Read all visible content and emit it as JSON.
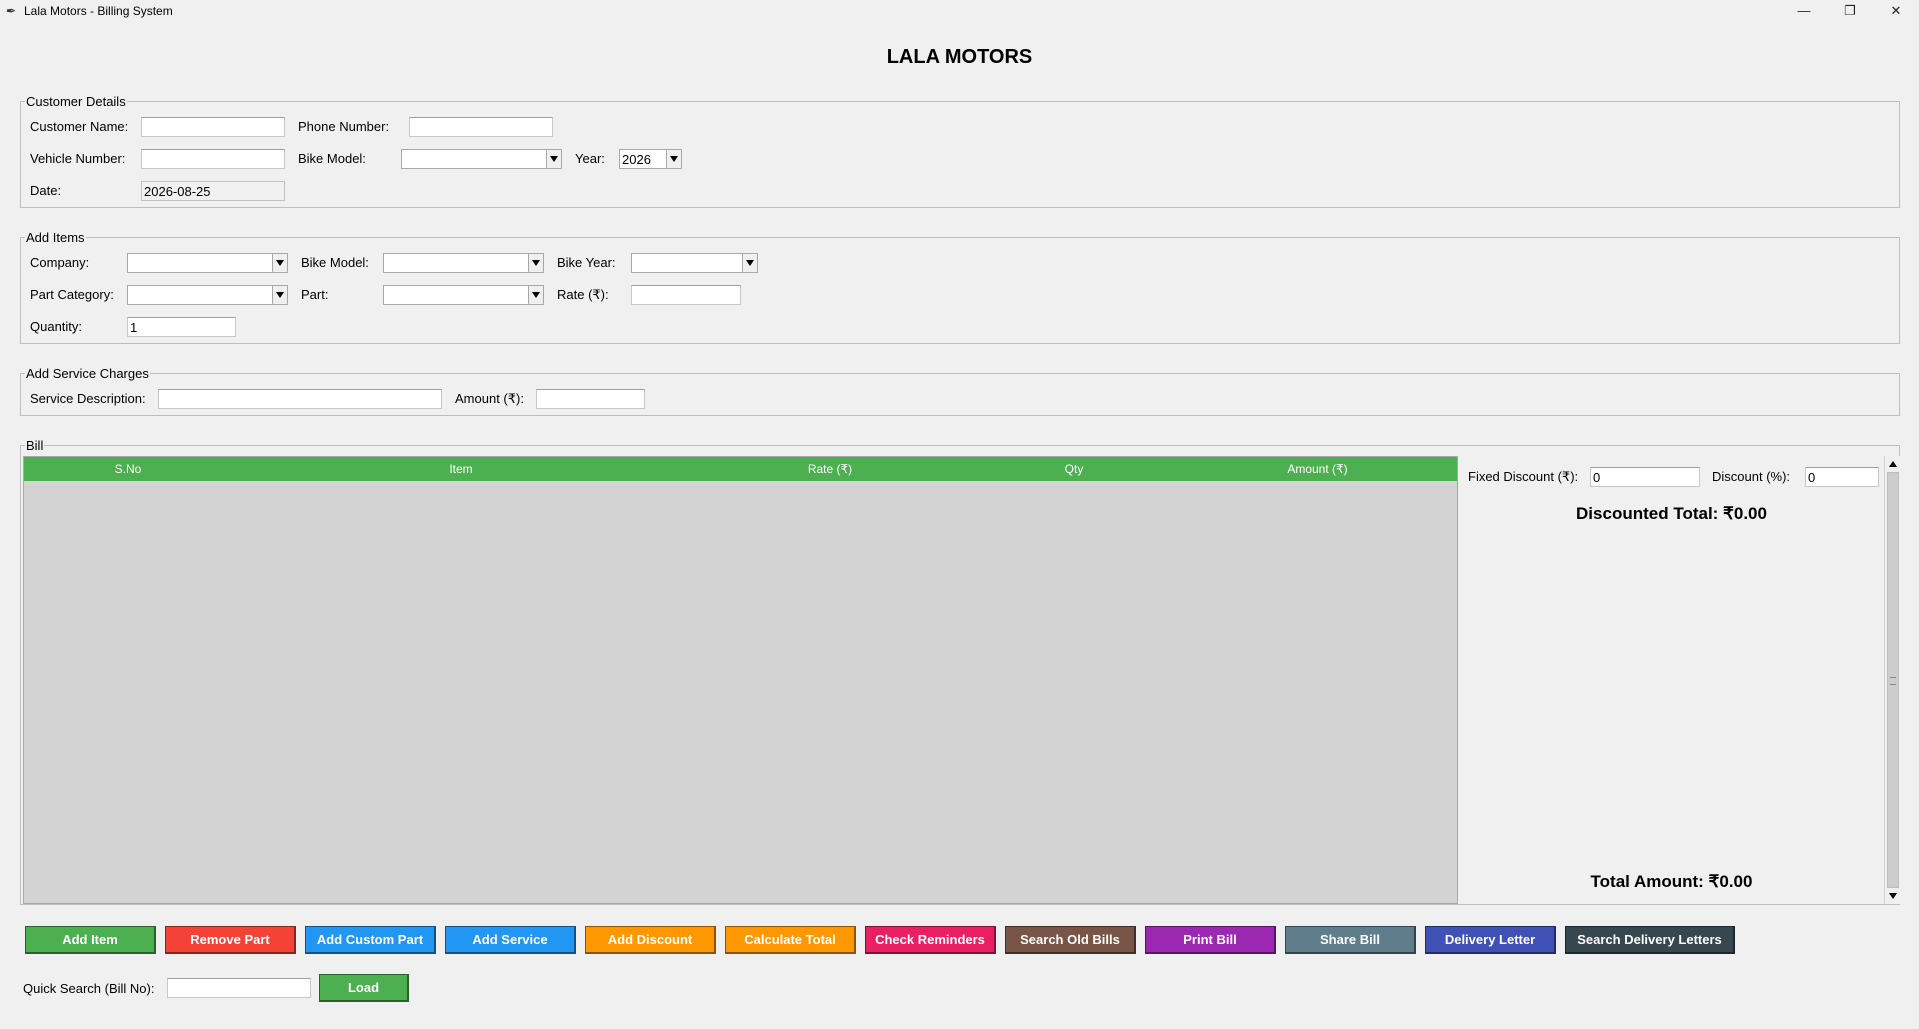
{
  "window": {
    "title": "Lala Motors - Billing System",
    "minimize_glyph": "—",
    "restore_glyph": "❐",
    "close_glyph": "✕"
  },
  "app": {
    "heading": "LALA MOTORS"
  },
  "customer_details": {
    "legend": "Customer Details",
    "customer_name_label": "Customer Name:",
    "customer_name_value": "",
    "phone_label": "Phone Number:",
    "phone_value": "",
    "vehicle_number_label": "Vehicle Number:",
    "vehicle_number_value": "",
    "bike_model_label": "Bike Model:",
    "bike_model_value": "",
    "year_label": "Year:",
    "year_value": "2026",
    "date_label": "Date:",
    "date_value": "2026-08-25"
  },
  "add_items": {
    "legend": "Add Items",
    "company_label": "Company:",
    "company_value": "",
    "bike_model_label": "Bike Model:",
    "bike_model_value": "",
    "bike_year_label": "Bike Year:",
    "bike_year_value": "",
    "part_category_label": "Part Category:",
    "part_category_value": "",
    "part_label": "Part:",
    "part_value": "",
    "rate_label": "Rate (₹):",
    "rate_value": "",
    "quantity_label": "Quantity:",
    "quantity_value": "1"
  },
  "service_charges": {
    "legend": "Add Service Charges",
    "description_label": "Service Description:",
    "description_value": "",
    "amount_label": "Amount (₹):",
    "amount_value": ""
  },
  "bill": {
    "legend": "Bill",
    "columns": [
      "S.No",
      "Item",
      "Rate (₹)",
      "Qty",
      "Amount (₹)"
    ],
    "rows": [],
    "header_color": "#4caf50",
    "fixed_discount_label": "Fixed Discount (₹):",
    "fixed_discount_value": "0",
    "discount_percent_label": "Discount (%):",
    "discount_percent_value": "0",
    "discounted_total": "Discounted Total: ₹0.00",
    "total_amount": "Total Amount: ₹0.00"
  },
  "actions": [
    {
      "label": "Add Item",
      "color": "#4caf50"
    },
    {
      "label": "Remove Part",
      "color": "#f44336"
    },
    {
      "label": "Add Custom Part",
      "color": "#2196f3"
    },
    {
      "label": "Add Service",
      "color": "#2196f3"
    },
    {
      "label": "Add Discount",
      "color": "#ff9800"
    },
    {
      "label": "Calculate Total",
      "color": "#ff9800"
    },
    {
      "label": "Check Reminders",
      "color": "#e91e63"
    },
    {
      "label": "Search Old Bills",
      "color": "#795548"
    },
    {
      "label": "Print Bill",
      "color": "#9c27b0"
    },
    {
      "label": "Share Bill",
      "color": "#607d8b"
    },
    {
      "label": "Delivery Letter",
      "color": "#3f51b5"
    },
    {
      "label": "Search Delivery Letters",
      "color": "#37474f"
    }
  ],
  "quick_search": {
    "label": "Quick Search (Bill No):",
    "value": "",
    "load_label": "Load",
    "load_color": "#4caf50"
  }
}
